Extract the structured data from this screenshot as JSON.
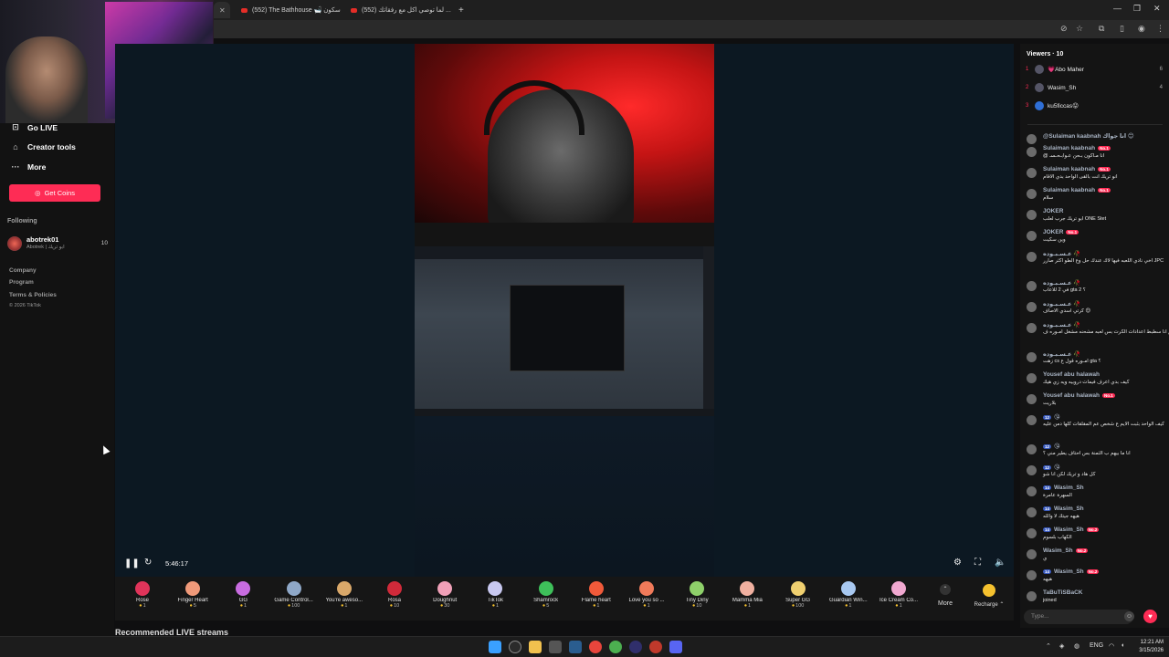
{
  "browser": {
    "tabs": [
      {
        "title": "(552) The Bathhouse 🛁 سكون"
      },
      {
        "title": "(552) لما توصي اكل مع رفقاتك ..."
      }
    ],
    "new_tab_icon": "plus-icon",
    "window_controls": [
      "—",
      "❐",
      "✕"
    ]
  },
  "sidebar": {
    "items": [
      {
        "label": "Go LIVE",
        "icon": "camera-icon"
      },
      {
        "label": "Creator tools",
        "icon": "home-icon"
      },
      {
        "label": "More",
        "icon": "dots-icon"
      }
    ],
    "get_coins_label": "Get Coins",
    "following_title": "Following",
    "following": [
      {
        "name": "abotrek01",
        "subtitle": "Abotrek | ابو تريك",
        "count": "10"
      }
    ],
    "footer_links": [
      "Company",
      "Program",
      "Terms & Policies",
      "© 2026 TikTok"
    ]
  },
  "player": {
    "timer": "5:46:17",
    "controls": {
      "pause_icon": "pause-icon",
      "refresh_icon": "refresh-icon",
      "settings_icon": "gear-icon",
      "fullscreen_icon": "fullscreen-icon",
      "volume_icon": "volume-icon"
    }
  },
  "gifts": [
    {
      "name": "Rose",
      "price": "1",
      "color": "#e0345a"
    },
    {
      "name": "Finger Heart",
      "price": "5",
      "color": "#f09a7a"
    },
    {
      "name": "GG",
      "price": "1",
      "color": "#c86ce0"
    },
    {
      "name": "Game Control...",
      "price": "100",
      "color": "#8fa8c8"
    },
    {
      "name": "You're aweso...",
      "price": "1",
      "color": "#d9a86a"
    },
    {
      "name": "Rosa",
      "price": "10",
      "color": "#d02a3a"
    },
    {
      "name": "Doughnut",
      "price": "30",
      "color": "#f0a0b8"
    },
    {
      "name": "TikTok",
      "price": "1",
      "color": "#c8c8f0"
    },
    {
      "name": "Shamrock",
      "price": "5",
      "color": "#3ec05a"
    },
    {
      "name": "Flame heart",
      "price": "1",
      "color": "#f05a3a"
    },
    {
      "name": "Love you so ...",
      "price": "1",
      "color": "#f07a5a"
    },
    {
      "name": "Tiny Diny",
      "price": "10",
      "color": "#8ed06a"
    },
    {
      "name": "Mamma Mia",
      "price": "1",
      "color": "#f0b0a0"
    },
    {
      "name": "Super GG",
      "price": "100",
      "color": "#f0d070"
    },
    {
      "name": "Guardian Win...",
      "price": "1",
      "color": "#a8c8f0"
    },
    {
      "name": "Ice Cream Co...",
      "price": "1",
      "color": "#f0a8d0"
    }
  ],
  "gift_more_label": "More",
  "recharge_label": "Recharge ⌃",
  "recommended_title": "Recommended LIVE streams",
  "viewers": {
    "title": "Viewers · 10",
    "list": [
      {
        "rank": "1",
        "name": "💗Abo Maher",
        "score": "6"
      },
      {
        "rank": "2",
        "name": "Wasim_Sh",
        "score": "4"
      },
      {
        "rank": "3",
        "name": "ku5ficcas😛",
        "score": ""
      }
    ]
  },
  "chat": [
    {
      "name": "@Sulaiman kaabnah انا جواك 😊",
      "badge": "",
      "level": "",
      "text": ""
    },
    {
      "name": "Sulaiman kaabnah",
      "badge": "No.1",
      "level": "",
      "text": "@ انا مـاكون بـحن عـوابـحـسـ"
    },
    {
      "name": "Sulaiman kaabnah",
      "badge": "No.1",
      "level": "",
      "text": "انو تريك انت بالقى الواحد بدي الاقام"
    },
    {
      "name": "Sulaiman kaabnah",
      "badge": "No.1",
      "level": "",
      "text": "سلام"
    },
    {
      "name": "JOKER",
      "badge": "",
      "level": "",
      "text": "ابو تريك جرب لعلب ONE Stet"
    },
    {
      "name": "JOKER",
      "badge": "No.1",
      "level": "",
      "text": "وين سكيت"
    },
    {
      "name": "عـسـبـوده 🥀",
      "badge": "",
      "level": "",
      "text": "اخي نادي اللعبه فيها لاك عندك حل وع الطو اكثر صارر JPC"
    },
    {
      "name": "عـسـبـوده 🥀",
      "badge": "",
      "level": "",
      "text": "في 2 للاعاب gta 2 ؟"
    },
    {
      "name": "عـسـبـوده 🥀",
      "badge": "",
      "level": "",
      "text": "كرتي اسدي الاصاف 😊"
    },
    {
      "name": "عـسـبـوده 🥀",
      "badge": "",
      "level": "",
      "text": "معلم انا سطبط اعدادات الكرت بس لعبه مشحنه مشغل امـوره ف gta 5"
    },
    {
      "name": "عـسـبـوده 🥀",
      "badge": "",
      "level": "",
      "text": "زهت cs امـوره قول ع gta ؟"
    },
    {
      "name": "Yousef abu halawah",
      "badge": "",
      "level": "",
      "text": "كيف بدي اعرف فيمات دروبيه ويه زي هيك"
    },
    {
      "name": "Yousef abu halawah",
      "badge": "No.1",
      "level": "",
      "text": "بلاريت"
    },
    {
      "name": "😘",
      "badge": "",
      "level": "12",
      "text": "كيف الواحد بثبت الايم ع شخص عم المقلقات كلها دمن عليه"
    },
    {
      "name": "😘",
      "badge": "",
      "level": "12",
      "text": "انا ما بيهم ب الثمنة بس احتاف يطير مني ؟"
    },
    {
      "name": "😘",
      "badge": "",
      "level": "12",
      "text": "كل هاد و تريك لكن انا شو"
    },
    {
      "name": "Wasim_Sh",
      "badge": "",
      "level": "14",
      "text": "السهرة عامرة"
    },
    {
      "name": "Wasim_Sh",
      "badge": "",
      "level": "14",
      "text": "هيهه جيتك لا والله"
    },
    {
      "name": "Wasim_Sh",
      "badge": "No.2",
      "level": "14",
      "text": "الكهاب بلسوم"
    },
    {
      "name": "Wasim_Sh",
      "badge": "No.2",
      "level": "",
      "text": "ي"
    },
    {
      "name": "Wasim_Sh",
      "badge": "No.2",
      "level": "14",
      "text": "هيهه"
    },
    {
      "name": "TaBuTiSBaCK",
      "badge": "",
      "level": "",
      "text": "joined"
    }
  ],
  "chat_input_placeholder": "Type...",
  "taskbar": {
    "language": "ENG",
    "time": "12:21 AM",
    "date": "3/15/2026"
  },
  "colors": {
    "accent": "#fe2c55",
    "panel": "#141414",
    "video_bg": "#0c1822"
  }
}
